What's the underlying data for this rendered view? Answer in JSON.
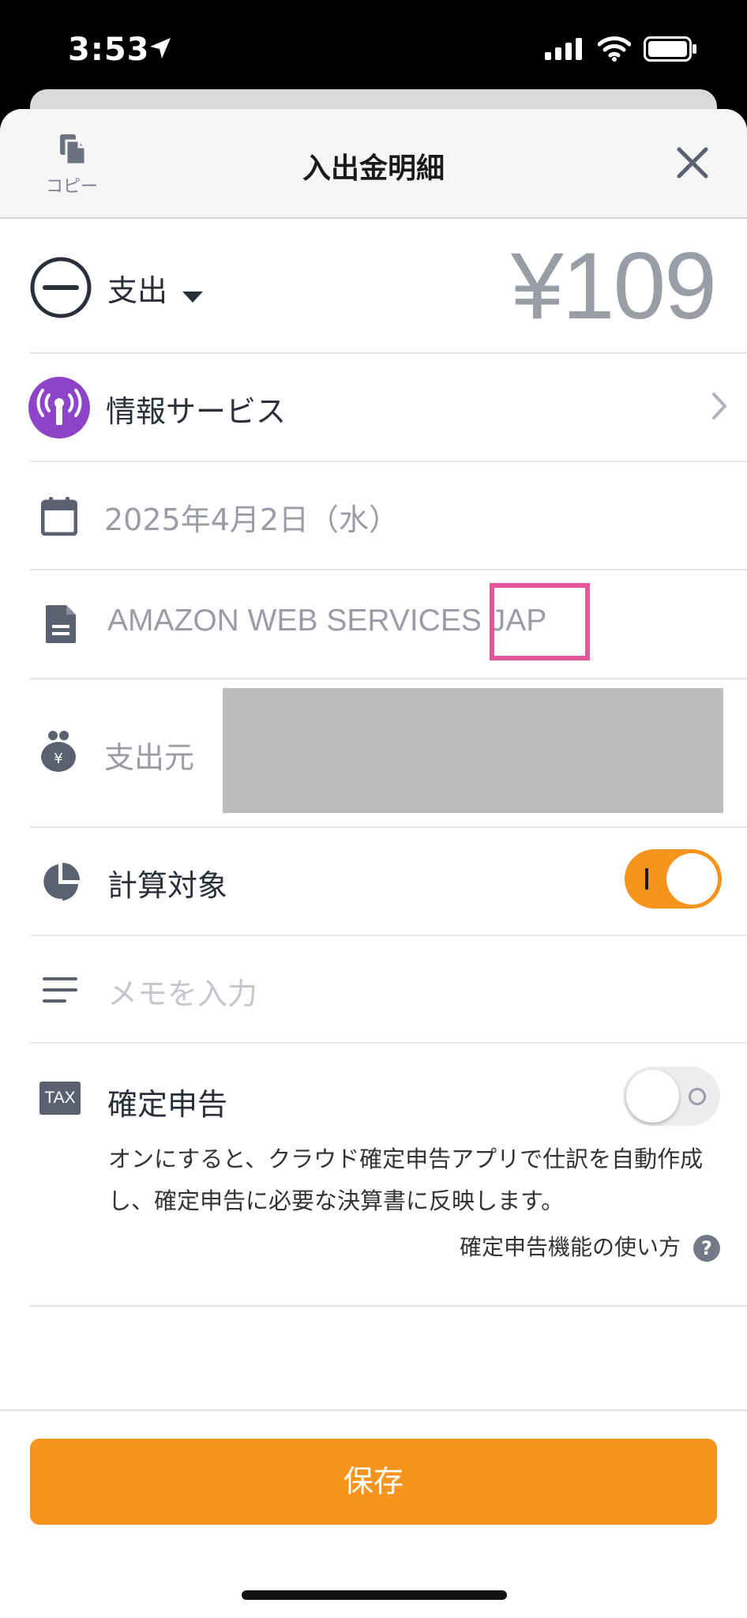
{
  "status_bar": {
    "time": "3:53"
  },
  "nav": {
    "copy_label": "コピー",
    "title": "入出金明細"
  },
  "type_row": {
    "label": "支出",
    "amount": "¥109"
  },
  "category_row": {
    "label": "情報サービス"
  },
  "date_row": {
    "value": "2025年4月2日（水）"
  },
  "description_row": {
    "value": "AMAZON WEB SERVICES JAP"
  },
  "source_row": {
    "label": "支出元"
  },
  "calc_row": {
    "label": "計算対象",
    "enabled": true
  },
  "memo_row": {
    "placeholder": "メモを入力"
  },
  "tax_row": {
    "badge": "TAX",
    "label": "確定申告",
    "enabled": false,
    "description": "オンにすると、クラウド確定申告アプリで仕訳を自動作成し、確定申告に必要な決算書に反映します。",
    "help_link": "確定申告機能の使い方",
    "help_icon": "?"
  },
  "save_button": {
    "label": "保存"
  },
  "colors": {
    "accent": "#f7941d",
    "category_icon_bg": "#8e44c9",
    "highlight": "#e4589a",
    "muted_text": "#9a9da6"
  }
}
